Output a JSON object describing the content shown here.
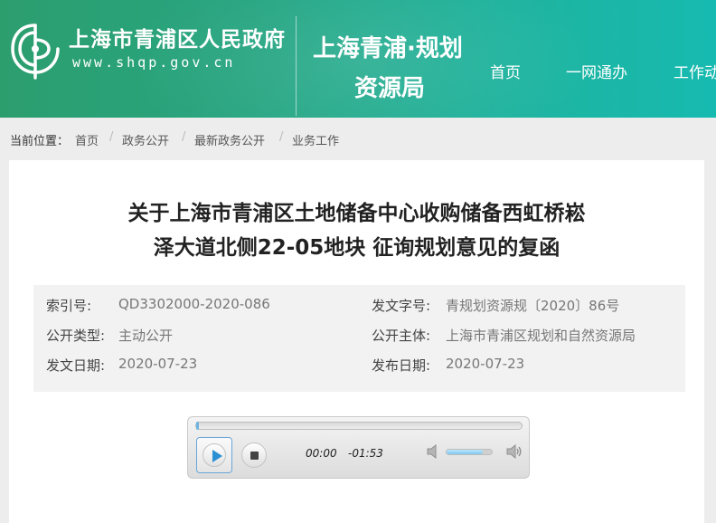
{
  "header": {
    "gov_name": "上海市青浦区人民政府",
    "gov_url": "www.shqp.gov.cn",
    "bureau_line1": "上海青浦·规划",
    "bureau_line2": "资源局",
    "nav": [
      "首页",
      "一网通办",
      "工作动"
    ],
    "accent_color": "#27a581",
    "logo_icon": "qingpu-emblem-icon"
  },
  "breadcrumb": {
    "label": "当前位置：",
    "items": [
      "首页",
      "政务公开",
      "最新政务公开",
      "业务工作"
    ],
    "separator": "/"
  },
  "article": {
    "title_line1": "关于上海市青浦区土地储备中心收购储备西虹桥崧",
    "title_line2": "泽大道北侧22-05地块 征询规划意见的复函",
    "meta": {
      "index_label": "索引号:",
      "index_value": "QD3302000-2020-086",
      "doc_no_label": "发文字号:",
      "doc_no_value": "青规划资源规〔2020〕86号",
      "open_type_label": "公开类型:",
      "open_type_value": "主动公开",
      "open_subject_label": "公开主体:",
      "open_subject_value": "上海市青浦区规划和自然资源局",
      "issue_date_label": "发文日期:",
      "issue_date_value": "2020-07-23",
      "publish_date_label": "发布日期:",
      "publish_date_value": "2020-07-23"
    }
  },
  "player": {
    "time_current": "00:00",
    "time_remaining": "-01:53",
    "progress": 0.0,
    "volume": 0.8,
    "play_icon": "play-icon",
    "stop_icon": "stop-icon",
    "mute_icon": "volume-low-icon",
    "max_icon": "volume-high-icon"
  }
}
